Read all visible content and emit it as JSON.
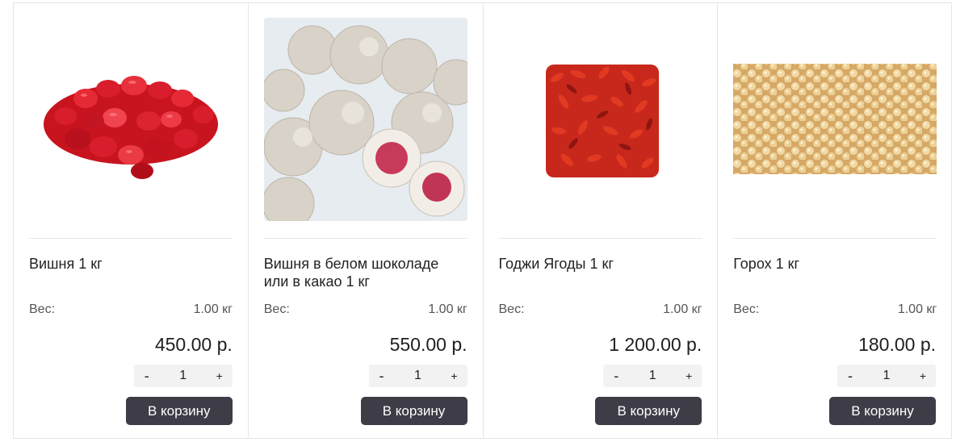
{
  "products": [
    {
      "title": "Вишня 1 кг",
      "weight_label": "Вес:",
      "weight_value": "1.00 кг",
      "price": "450.00 р.",
      "qty": "1",
      "minus": "-",
      "plus": "+",
      "cart_label": "В корзину"
    },
    {
      "title": "Вишня в белом шоколаде или в какао 1 кг",
      "weight_label": "Вес:",
      "weight_value": "1.00 кг",
      "price": "550.00 р.",
      "qty": "1",
      "minus": "-",
      "plus": "+",
      "cart_label": "В корзину"
    },
    {
      "title": "Годжи Ягоды 1 кг",
      "weight_label": "Вес:",
      "weight_value": "1.00 кг",
      "price": "1 200.00 р.",
      "qty": "1",
      "minus": "-",
      "plus": "+",
      "cart_label": "В корзину"
    },
    {
      "title": "Горох 1 кг",
      "weight_label": "Вес:",
      "weight_value": "1.00 кг",
      "price": "180.00 р.",
      "qty": "1",
      "minus": "-",
      "plus": "+",
      "cart_label": "В корзину"
    }
  ],
  "colors": {
    "button_bg": "#3d3c47",
    "stepper_bg": "#f2f2f2",
    "border": "#e6e6e6"
  }
}
